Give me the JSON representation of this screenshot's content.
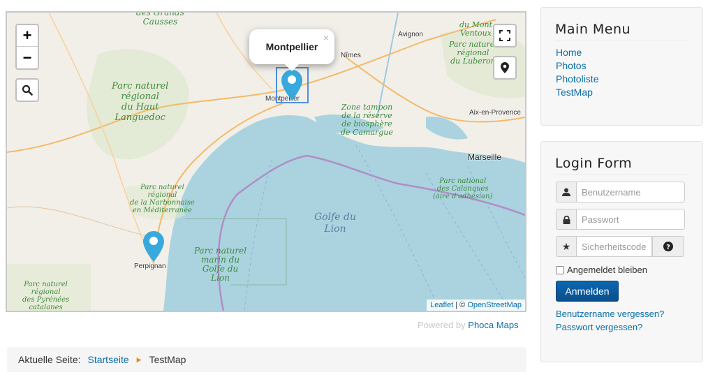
{
  "map": {
    "zoom_in": "+",
    "zoom_out": "−",
    "popup_title": "Montpellier",
    "popup_close": "×",
    "attribution_leaflet": "Leaflet",
    "attribution_sep": "| ©",
    "attribution_osm": "OpenStreetMap",
    "labels": {
      "causses": "des Grands\nCausses",
      "haut_languedoc": "Parc naturel\nrégional\ndu Haut\nLanguedoc",
      "mont_ventoux": "du Mont\nVentoux",
      "luberon": "Parc naturel\nrégional\ndu Luberon",
      "camargue": "Zone tampon\nde la réserve\nde biosphère\nde Camargue",
      "narbonnaise": "Parc naturel\nrégional\nde la Narbonnaise\nen Méditerranée",
      "calanques": "Parc national\ndes Calanques\n(aire d'adhésion)",
      "golfe": "Golfe du\nLion",
      "marin": "Parc naturel\nmarin du\nGolfe du\nLion",
      "pyrenees": "Parc naturel\nrégional\ndes Pyrénées\ncatalanes"
    },
    "cities": {
      "avignon": "Avignon",
      "nimes": "Nîmes",
      "montpellier": "Montpellier",
      "aix": "Aix-en-Provence",
      "marseille": "Marseille",
      "perpignan": "Perpignan"
    },
    "marker_color": "#38a9dc"
  },
  "powered_by": {
    "prefix": "Powered by",
    "link": "Phoca Maps"
  },
  "breadcrumb": {
    "label": "Aktuelle Seite:",
    "home": "Startseite",
    "current": "TestMap"
  },
  "main_menu": {
    "title": "Main Menu",
    "items": [
      "Home",
      "Photos",
      "Photoliste",
      "TestMap"
    ]
  },
  "login": {
    "title": "Login Form",
    "username_placeholder": "Benutzername",
    "password_placeholder": "Passwort",
    "secret_placeholder": "Sicherheitscode",
    "remember": "Angemeldet bleiben",
    "submit": "Anmelden",
    "forgot_username": "Benutzername vergessen?",
    "forgot_password": "Passwort vergessen?"
  },
  "colors": {
    "link": "#0a6ea8",
    "button": "#0a5a9c",
    "sea": "#aad3df",
    "land": "#f2efe9"
  }
}
